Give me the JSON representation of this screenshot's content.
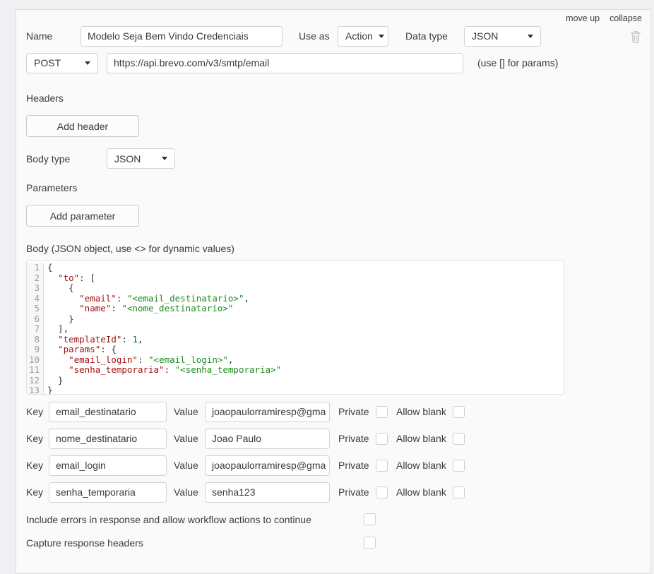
{
  "panel": {
    "actions": {
      "move_up": "move up",
      "collapse": "collapse"
    },
    "name_row": {
      "label": "Name",
      "value": "Modelo Seja Bem Vindo Credenciais",
      "use_as_label": "Use as",
      "use_as_value": "Action",
      "data_type_label": "Data type",
      "data_type_value": "JSON"
    },
    "request_row": {
      "method": "POST",
      "url": "https://api.brevo.com/v3/smtp/email",
      "note": "(use [] for params)"
    },
    "headers_section": {
      "label": "Headers",
      "add_button": "Add header"
    },
    "body_type": {
      "label": "Body type",
      "value": "JSON"
    },
    "parameters_section": {
      "label": "Parameters",
      "add_button": "Add parameter"
    },
    "body_section": {
      "label": "Body (JSON object, use <> for dynamic values)"
    },
    "code_editor": {
      "lines": [
        [
          [
            "pl",
            "{"
          ]
        ],
        [
          [
            "pl",
            "  "
          ],
          [
            "k",
            "\"to\""
          ],
          [
            "pl",
            ": ["
          ]
        ],
        [
          [
            "pl",
            "    {"
          ]
        ],
        [
          [
            "pl",
            "      "
          ],
          [
            "k",
            "\"email\""
          ],
          [
            "pl",
            ": "
          ],
          [
            "s",
            "\"<email_destinatario>\""
          ],
          [
            "pl",
            ","
          ]
        ],
        [
          [
            "pl",
            "      "
          ],
          [
            "k",
            "\"name\""
          ],
          [
            "pl",
            ": "
          ],
          [
            "s",
            "\"<nome_destinatario>\""
          ]
        ],
        [
          [
            "pl",
            "    }"
          ]
        ],
        [
          [
            "pl",
            "  ],"
          ]
        ],
        [
          [
            "pl",
            "  "
          ],
          [
            "k",
            "\"templateId\""
          ],
          [
            "pl",
            ": "
          ],
          [
            "n",
            "1"
          ],
          [
            "pl",
            ","
          ]
        ],
        [
          [
            "pl",
            "  "
          ],
          [
            "k",
            "\"params\""
          ],
          [
            "pl",
            ": {"
          ]
        ],
        [
          [
            "pl",
            "    "
          ],
          [
            "k",
            "\"email_login\""
          ],
          [
            "pl",
            ": "
          ],
          [
            "s",
            "\"<email_login>\""
          ],
          [
            "pl",
            ","
          ]
        ],
        [
          [
            "pl",
            "    "
          ],
          [
            "k",
            "\"senha_temporaria\""
          ],
          [
            "pl",
            ": "
          ],
          [
            "s",
            "\"<senha_temporaria>\""
          ]
        ],
        [
          [
            "pl",
            "  }"
          ]
        ],
        [
          [
            "pl",
            "}"
          ]
        ]
      ]
    },
    "param_rows": {
      "key_label": "Key",
      "value_label": "Value",
      "private_label": "Private",
      "allow_blank_label": "Allow blank",
      "rows": [
        {
          "key": "email_destinatario",
          "value": "joaopaulorramiresp@gma",
          "private": false,
          "allow_blank": false
        },
        {
          "key": "nome_destinatario",
          "value": "Joao Paulo",
          "private": false,
          "allow_blank": false
        },
        {
          "key": "email_login",
          "value": "joaopaulorramiresp@gma",
          "private": false,
          "allow_blank": false
        },
        {
          "key": "senha_temporaria",
          "value": "senha123",
          "private": false,
          "allow_blank": false
        }
      ]
    },
    "footer": {
      "include_errors_label": "Include errors in response and allow workflow actions to continue",
      "include_errors_checked": false,
      "capture_headers_label": "Capture response headers",
      "capture_headers_checked": false
    }
  },
  "colors": {
    "panel_background": "#fafafa",
    "page_background": "#f0f0f2",
    "syntax_key": "#a31111",
    "syntax_string": "#1e8a1e",
    "syntax_number": "#116644",
    "line_number": "#9b9ba6"
  }
}
